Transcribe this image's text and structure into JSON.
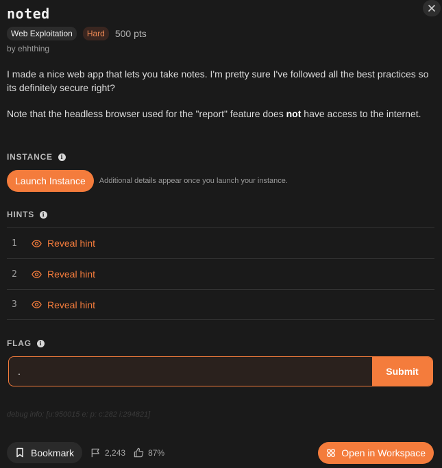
{
  "challenge": {
    "title": "noted",
    "category": "Web Exploitation",
    "difficulty": "Hard",
    "points": "500 pts",
    "author": "by ehhthing"
  },
  "description": {
    "p1": "I made a nice web app that lets you take notes. I'm pretty sure I've followed all the best practices so its definitely secure right?",
    "p2_before": "Note that the headless browser used for the \"report\" feature does ",
    "p2_bold": "not",
    "p2_after": " have access to the internet."
  },
  "instance": {
    "label": "INSTANCE",
    "launch_label": "Launch Instance",
    "note": "Additional details appear once you launch your instance."
  },
  "hints": {
    "label": "HINTS",
    "items": [
      {
        "num": "1",
        "label": "Reveal hint"
      },
      {
        "num": "2",
        "label": "Reveal hint"
      },
      {
        "num": "3",
        "label": "Reveal hint"
      }
    ]
  },
  "flag": {
    "label": "FLAG",
    "value": ".",
    "submit_label": "Submit"
  },
  "debug": "debug info: [u:950015 e: p: c:282 i:294821]",
  "footer": {
    "bookmark_label": "Bookmark",
    "solves": "2,243",
    "rating": "87%",
    "workspace_label": "Open in Workspace"
  },
  "colors": {
    "accent": "#f47c3c",
    "background": "#1a1a1a",
    "difficulty": "#f08a55"
  }
}
